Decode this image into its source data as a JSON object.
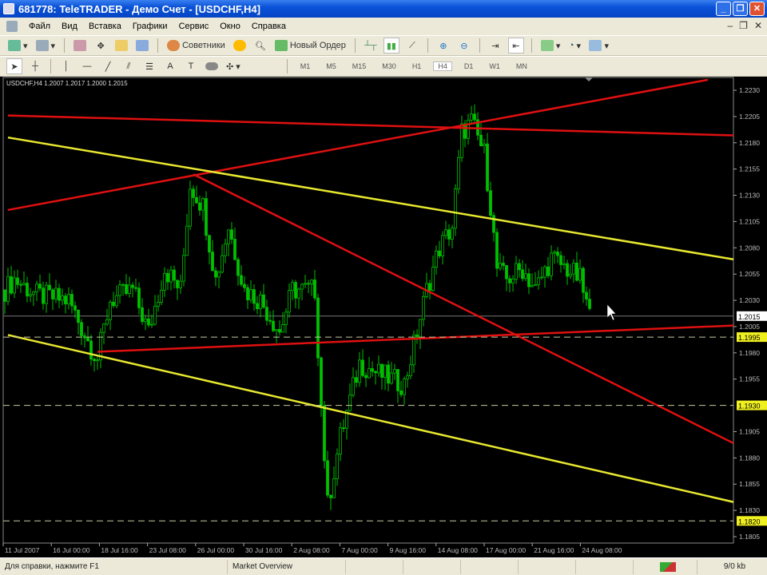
{
  "window": {
    "title": "681778: TeleTRADER - Демо Счет - [USDCHF,H4]"
  },
  "menu": [
    "Файл",
    "Вид",
    "Вставка",
    "Графики",
    "Сервис",
    "Окно",
    "Справка"
  ],
  "toolbar": {
    "experts_label": "Советники",
    "new_order_label": "Новый Ордер"
  },
  "timeframes": [
    "M1",
    "M5",
    "M15",
    "M30",
    "H1",
    "H4",
    "D1",
    "W1",
    "MN"
  ],
  "active_timeframe": "H4",
  "chart_info": "USDCHF,H4  1.2007 1.2017 1.2000 1.2015",
  "chart_data": {
    "type": "candlestick",
    "symbol": "USDCHF",
    "timeframe": "H4",
    "ylim": [
      1.1795,
      1.2242
    ],
    "price_ticks": [
      "1.2230",
      "1.2205",
      "1.2180",
      "1.2155",
      "1.2130",
      "1.2105",
      "1.2080",
      "1.2055",
      "1.2030",
      "1.2005",
      "1.1980",
      "1.1955",
      "1.1905",
      "1.1880",
      "1.1855",
      "1.1830",
      "1.1805"
    ],
    "time_labels": [
      "11 Jul 2007",
      "16 Jul 00:00",
      "18 Jul 16:00",
      "23 Jul 08:00",
      "26 Jul 00:00",
      "30 Jul 16:00",
      "2 Aug 08:00",
      "7 Aug 00:00",
      "9 Aug 16:00",
      "14 Aug 08:00",
      "17 Aug 00:00",
      "21 Aug 16:00",
      "24 Aug 08:00"
    ],
    "price_path": [
      [
        0,
        1.204
      ],
      [
        3,
        1.205
      ],
      [
        10,
        1.2035
      ],
      [
        20,
        1.203
      ],
      [
        27,
        1.1985
      ],
      [
        29,
        1.1975
      ],
      [
        33,
        1.203
      ],
      [
        40,
        1.204
      ],
      [
        45,
        1.2
      ],
      [
        50,
        1.206
      ],
      [
        55,
        1.204
      ],
      [
        58,
        1.214
      ],
      [
        62,
        1.212
      ],
      [
        66,
        1.205
      ],
      [
        70,
        1.21
      ],
      [
        75,
        1.204
      ],
      [
        80,
        1.203
      ],
      [
        86,
        1.2
      ],
      [
        90,
        1.204
      ],
      [
        97,
        1.204
      ],
      [
        99,
        1.193
      ],
      [
        101,
        1.1835
      ],
      [
        105,
        1.19
      ],
      [
        111,
        1.197
      ],
      [
        117,
        1.196
      ],
      [
        125,
        1.195
      ],
      [
        129,
        1.2
      ],
      [
        132,
        1.204
      ],
      [
        136,
        1.208
      ],
      [
        140,
        1.21
      ],
      [
        143,
        1.219
      ],
      [
        146,
        1.22
      ],
      [
        150,
        1.217
      ],
      [
        152,
        1.212
      ],
      [
        154,
        1.206
      ],
      [
        157,
        1.205
      ],
      [
        162,
        1.206
      ],
      [
        166,
        1.204
      ],
      [
        171,
        1.207
      ],
      [
        176,
        1.206
      ],
      [
        180,
        1.205
      ],
      [
        183,
        1.2015
      ]
    ],
    "trendlines": [
      {
        "color": "#e01010",
        "from": [
          1,
          1.2206
        ],
        "to": [
          229.5,
          1.2187
        ]
      },
      {
        "color": "#e01010",
        "from": [
          1,
          1.2116
        ],
        "to": [
          220,
          1.224
        ]
      },
      {
        "color": "#e8e830",
        "from": [
          1,
          1.2185
        ],
        "to": [
          229.5,
          1.2069
        ]
      },
      {
        "color": "#e8e830",
        "from": [
          1,
          1.1997
        ],
        "to": [
          229.5,
          1.1838
        ]
      },
      {
        "color": "#e01010",
        "from": [
          59,
          1.215
        ],
        "to": [
          229.5,
          1.1894
        ]
      },
      {
        "color": "#e01010",
        "from": [
          29,
          1.1981
        ],
        "to": [
          229.5,
          1.2006
        ]
      }
    ],
    "hlines": [
      {
        "price": "1.1995",
        "style": "dashed"
      },
      {
        "price": "1.1930",
        "style": "dashed"
      },
      {
        "price": "1.1820",
        "style": "dashed"
      }
    ],
    "bid": "1.2015",
    "candle_color": "#00c000"
  },
  "status": {
    "help": "Для справки, нажмите F1",
    "profile": "Market Overview",
    "traffic": "9/0 kb"
  }
}
